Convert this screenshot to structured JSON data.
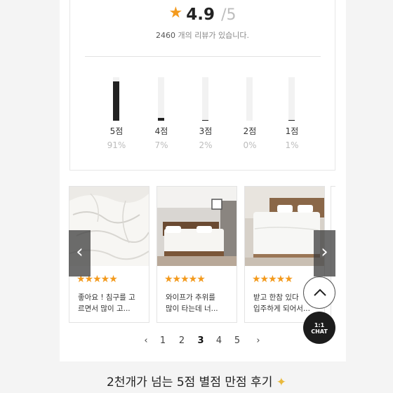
{
  "summary": {
    "score": "4.9",
    "score_max": "/5",
    "review_count": "2460",
    "review_count_suffix": "개의 리뷰가 있습니다."
  },
  "distribution": [
    {
      "label": "5점",
      "pct": "91%",
      "fraction": 0.91
    },
    {
      "label": "4점",
      "pct": "7%",
      "fraction": 0.07
    },
    {
      "label": "3점",
      "pct": "2%",
      "fraction": 0.02
    },
    {
      "label": "2점",
      "pct": "0%",
      "fraction": 0.0
    },
    {
      "label": "1점",
      "pct": "1%",
      "fraction": 0.01
    }
  ],
  "reviews": [
    {
      "stars": "★★★★★",
      "line1": "좋아요 ! 침구를 고",
      "line2": "르면서 많이 고..."
    },
    {
      "stars": "★★★★★",
      "line1": "와이프가 추위를",
      "line2": "많이 타는데 너..."
    },
    {
      "stars": "★★★★★",
      "line1": "받고 한참 있다",
      "line2": "입주하게 되어서..."
    }
  ],
  "carousel": {
    "prev_icon": "‹",
    "next_icon": "›"
  },
  "pagination": {
    "prev": "‹",
    "pages": [
      "1",
      "2",
      "3",
      "4",
      "5"
    ],
    "current": "3",
    "next": "›"
  },
  "floating": {
    "top_icon": "chevron-up-icon",
    "chat_line1": "1:1",
    "chat_line2": "CHAT"
  },
  "footer": {
    "title": "2천개가 넘는 5점 별점 만점 후기"
  },
  "colors": {
    "accent": "#f39a1d",
    "bar": "#222222"
  }
}
